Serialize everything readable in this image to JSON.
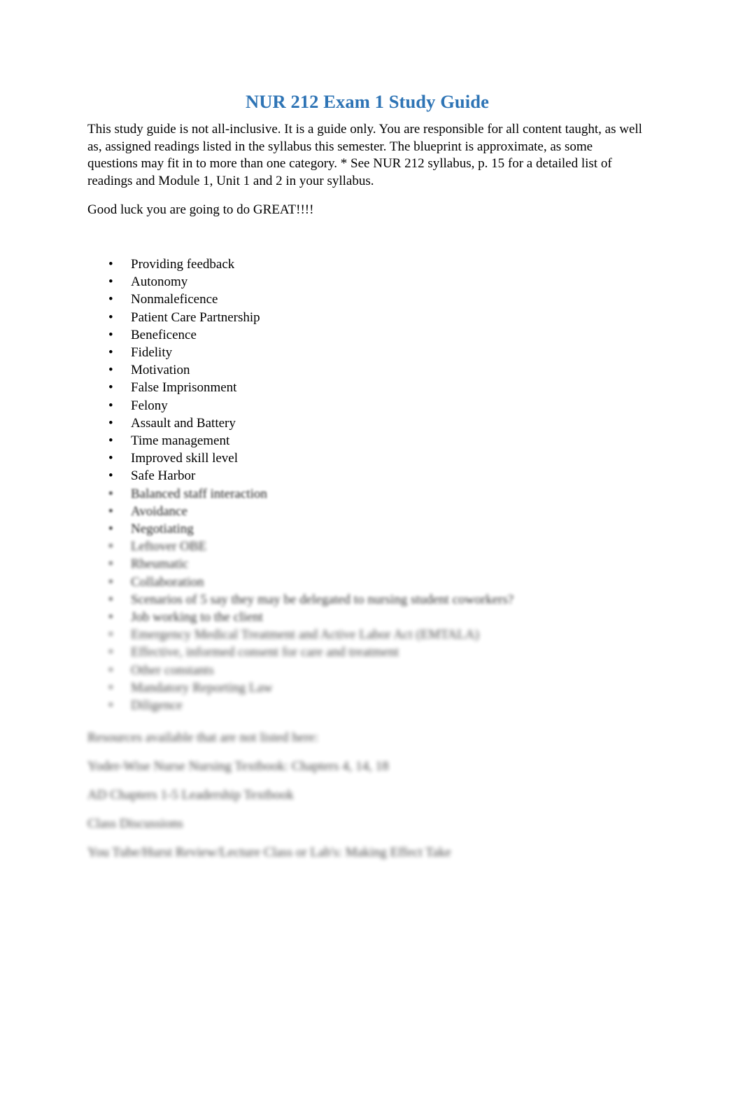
{
  "document": {
    "title": "NUR 212 Exam 1 Study Guide",
    "intro_paragraph": "This study guide is not all-inclusive. It is a guide only. You are responsible for all content taught, as well as, assigned readings listed in the syllabus this semester. The blueprint is approximate, as some questions may fit in to more than one category. * See NUR 212 syllabus, p. 15 for a detailed list of readings and Module 1, Unit 1 and 2 in your syllabus.",
    "good_luck_line": "Good luck you are going to do GREAT!!!!",
    "bullet_marker": "•",
    "bullets_clear": [
      "Providing feedback",
      "Autonomy",
      "Nonmaleficence",
      "Patient Care Partnership",
      "Beneficence",
      "Fidelity",
      "Motivation",
      "False Imprisonment",
      "Felony",
      "Assault and Battery",
      "Time management",
      "Improved skill level",
      "Safe Harbor"
    ],
    "bullets_blurred": [
      "Balanced staff interaction",
      "Avoidance",
      "Negotiating",
      "Leftover OBE",
      "Rheumatic",
      "Collaboration",
      "Scenarios of 5 say they may be delegated to nursing student coworkers?",
      "Job working to the client",
      "Emergency Medical Treatment and Active Labor Act (EMTALA)",
      "Effective, informed consent for care and treatment",
      "Other constants",
      "Mandatory Reporting Law",
      "Diligence"
    ],
    "tail_paragraphs": [
      "Resources available that are not listed here:",
      "Yoder-Wise Nurse Nursing Textbook: Chapters 4, 14, 18",
      "AD Chapters 1-5 Leadership Textbook",
      "Class Discussions",
      "You Tube/Hurst Review/Lecture Class or Lab's: Making Effect Take"
    ]
  }
}
